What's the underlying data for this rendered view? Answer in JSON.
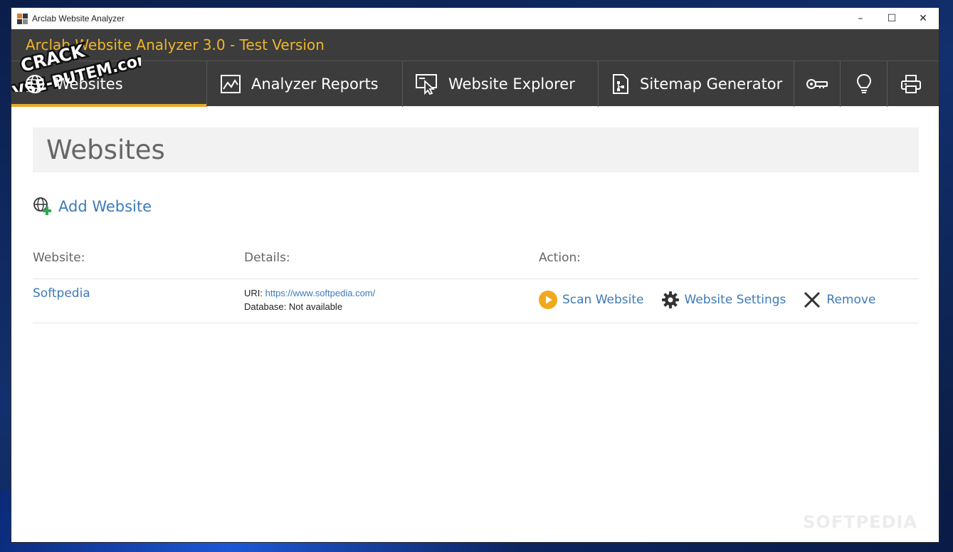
{
  "window": {
    "title": "Arclab Website Analyzer",
    "minimize": "–",
    "maximize": "☐",
    "close": "✕"
  },
  "app": {
    "title": "Arclab Website Analyzer 3.0 - Test Version",
    "accent_color": "#e8a92a",
    "title_color": "#f0b52a"
  },
  "watermark": {
    "line1": "CRACK",
    "line2": "VSE-PUTEM.com",
    "softpedia": "SOFTPEDIA"
  },
  "nav": {
    "tabs": [
      {
        "label": "Websites",
        "icon": "globe-icon",
        "active": true
      },
      {
        "label": "Analyzer Reports",
        "icon": "chart-icon",
        "active": false
      },
      {
        "label": "Website Explorer",
        "icon": "explorer-icon",
        "active": false
      },
      {
        "label": "Sitemap Generator",
        "icon": "sitemap-icon",
        "active": false
      }
    ],
    "icon_buttons": [
      "key-icon",
      "lightbulb-icon",
      "printer-icon"
    ]
  },
  "page": {
    "title": "Websites",
    "add_website_label": "Add Website"
  },
  "table": {
    "headers": {
      "website": "Website:",
      "details": "Details:",
      "action": "Action:"
    },
    "rows": [
      {
        "name": "Softpedia",
        "uri_label": "URI:",
        "uri_value": "https://www.softpedia.com/",
        "database_label": "Database:",
        "database_value": "Not available",
        "actions": {
          "scan": "Scan Website",
          "settings": "Website Settings",
          "remove": "Remove"
        }
      }
    ]
  },
  "colors": {
    "link": "#3e7ab8",
    "bar": "#3c3c3c",
    "scan_icon": "#f0a81c"
  }
}
